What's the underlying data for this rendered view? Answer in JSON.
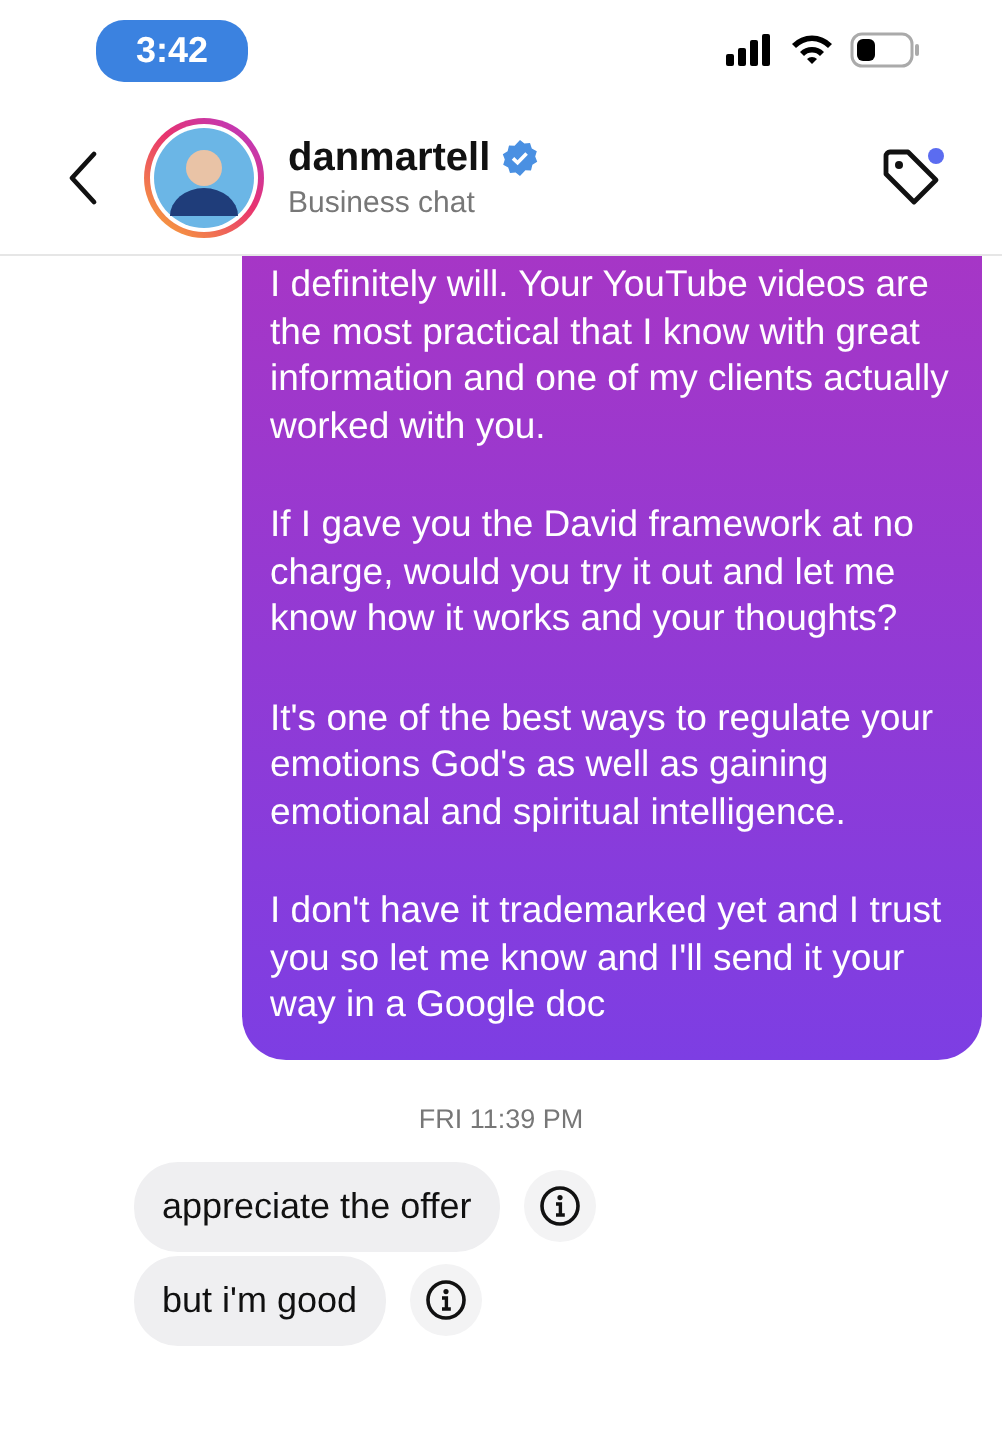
{
  "status_bar": {
    "time": "3:42"
  },
  "header": {
    "name": "danmartell",
    "verified": true,
    "subtitle": "Business chat",
    "has_new_label": true
  },
  "messages": [
    {
      "kind": "outgoing",
      "paragraphs": [
        "I definitely will. Your YouTube videos are the most practical that I know with great information and one of my clients actually worked with you.",
        "If I gave you the David framework at no charge, would you try it out and let me know how it works and your thoughts?",
        "It's one of the best ways to regulate your emotions God's as well as gaining emotional and spiritual intelligence.",
        "I don't have it trademarked yet and I trust you so let me know and I'll send it your way in a Google doc"
      ]
    },
    {
      "kind": "timestamp",
      "text": "FRI 11:39 PM"
    },
    {
      "kind": "incoming",
      "text": "appreciate the offer"
    },
    {
      "kind": "incoming",
      "text": "but i'm good"
    }
  ]
}
